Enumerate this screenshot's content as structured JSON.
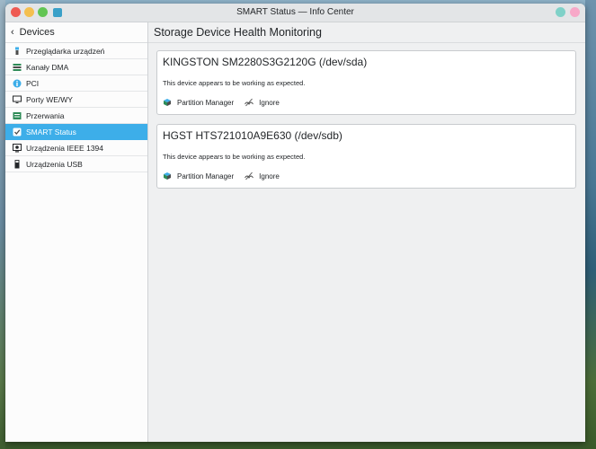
{
  "window": {
    "title": "SMART Status — Info Center"
  },
  "sidebar": {
    "header": "Devices",
    "items": [
      {
        "label": "Przeglądarka urządzeń",
        "icon": "device-tree-icon"
      },
      {
        "label": "Kanały DMA",
        "icon": "dma-icon"
      },
      {
        "label": "PCI",
        "icon": "pci-icon"
      },
      {
        "label": "Porty WE/WY",
        "icon": "monitor-icon"
      },
      {
        "label": "Przerwania",
        "icon": "interrupts-icon"
      },
      {
        "label": "SMART Status",
        "icon": "smart-icon",
        "active": true
      },
      {
        "label": "Urządzenia IEEE 1394",
        "icon": "firewire-icon"
      },
      {
        "label": "Urządzenia USB",
        "icon": "usb-icon"
      }
    ]
  },
  "main": {
    "title": "Storage Device Health Monitoring",
    "devices": [
      {
        "name": "KINGSTON SM2280S3G2120G (/dev/sda)",
        "status": "This device appears to be working as expected.",
        "partition_label": "Partition Manager",
        "ignore_label": "Ignore"
      },
      {
        "name": "HGST HTS721010A9E630 (/dev/sdb)",
        "status": "This device appears to be working as expected.",
        "partition_label": "Partition Manager",
        "ignore_label": "Ignore"
      }
    ]
  },
  "colors": {
    "accent": "#3daee9",
    "window_bg": "#eff0f1",
    "card_bg": "#ffffff"
  }
}
